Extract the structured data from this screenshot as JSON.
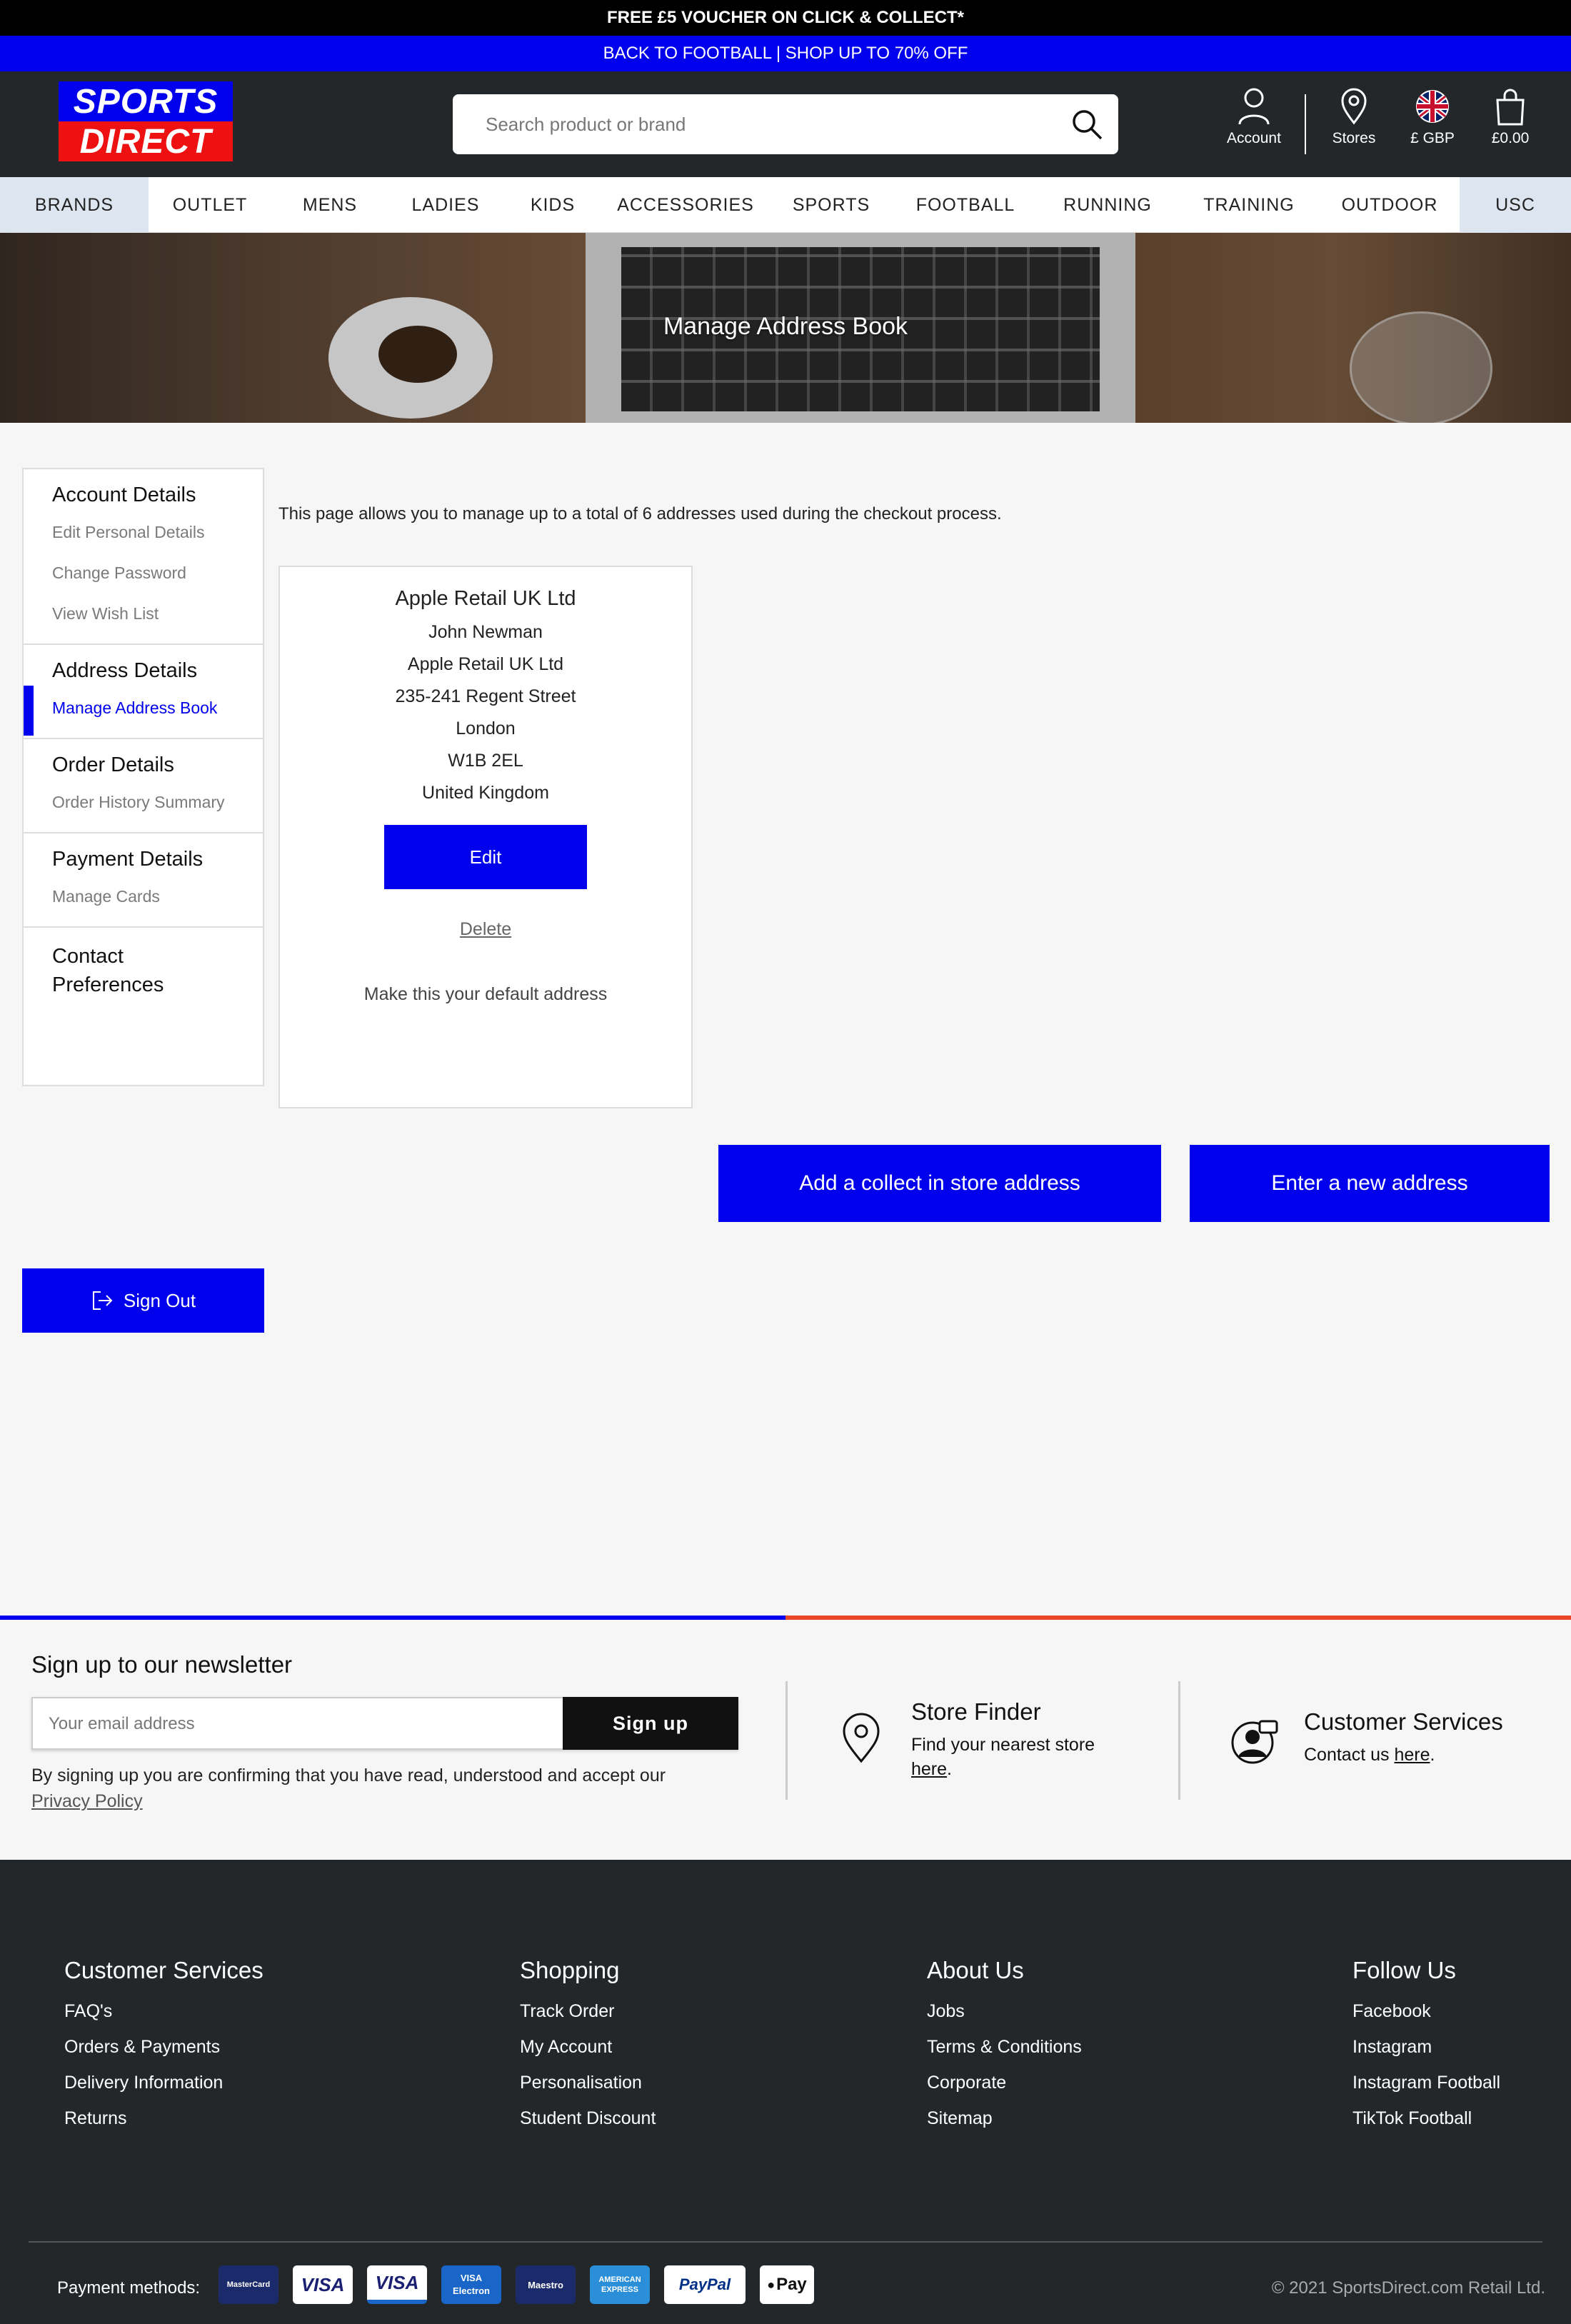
{
  "promo": {
    "line1": "FREE £5 VOUCHER ON CLICK & COLLECT*",
    "line2": "BACK TO FOOTBALL | SHOP UP TO 70% OFF"
  },
  "header": {
    "logo_top": "SPORTS",
    "logo_bottom": "DIRECT",
    "search_placeholder": "Search product or brand",
    "account": "Account",
    "stores": "Stores",
    "currency": "£ GBP",
    "basket": "£0.00"
  },
  "nav": [
    "BRANDS",
    "OUTLET",
    "MENS",
    "LADIES",
    "KIDS",
    "ACCESSORIES",
    "SPORTS",
    "FOOTBALL",
    "RUNNING",
    "TRAINING",
    "OUTDOOR",
    "USC"
  ],
  "hero": {
    "title": "Manage Address Book"
  },
  "sidebar": {
    "account_details": "Account Details",
    "edit_personal": "Edit Personal Details",
    "change_password": "Change Password",
    "view_wishlist": "View Wish List",
    "address_details": "Address Details",
    "manage_address": "Manage Address Book",
    "order_details": "Order Details",
    "order_history": "Order History Summary",
    "payment_details": "Payment Details",
    "manage_cards": "Manage Cards",
    "contact_prefs": "Contact Preferences",
    "sign_out": "Sign Out"
  },
  "main": {
    "intro": "This page allows you to manage up to a total of 6 addresses used during the checkout process.",
    "address": {
      "title": "Apple Retail UK Ltd",
      "name": "John  Newman",
      "company": "Apple Retail UK Ltd",
      "street": "235-241 Regent Street",
      "city": "London",
      "postcode": "W1B 2EL",
      "country": "United Kingdom",
      "edit": "Edit",
      "delete": "Delete",
      "default": "Make this your default address"
    },
    "add_collect": "Add a collect in store address",
    "new_address": "Enter a new address"
  },
  "newsletter": {
    "title": "Sign up to our newsletter",
    "placeholder": "Your email address",
    "button": "Sign up",
    "disclaimer": "By signing up you are confirming that you have read, understood and accept our",
    "privacy": "Privacy Policy",
    "store_finder": "Store Finder",
    "store_finder_sub": "Find your nearest store",
    "store_here": "here",
    "customer_services": "Customer Services",
    "contact_us": "Contact us",
    "contact_here": "here"
  },
  "footer": {
    "columns": [
      {
        "title": "Customer Services",
        "links": [
          "FAQ's",
          "Orders & Payments",
          "Delivery Information",
          "Returns"
        ]
      },
      {
        "title": "Shopping",
        "links": [
          "Track Order",
          "My Account",
          "Personalisation",
          "Student Discount"
        ]
      },
      {
        "title": "About Us",
        "links": [
          "Jobs",
          "Terms & Conditions",
          "Corporate",
          "Sitemap"
        ]
      },
      {
        "title": "Follow Us",
        "links": [
          "Facebook",
          "Instagram",
          "Instagram Football",
          "TikTok Football"
        ]
      }
    ],
    "payment_label": "Payment methods:",
    "cards": [
      "MasterCard",
      "VISA",
      "VISA",
      "VISA Electron",
      "Maestro",
      "AMERICAN EXPRESS",
      "PayPal",
      "Pay"
    ],
    "copyright": "© 2021 SportsDirect.com Retail Ltd."
  },
  "colors": {
    "brand_blue": "#0000ed",
    "brand_red": "#ee1111",
    "dark": "#24272a"
  }
}
